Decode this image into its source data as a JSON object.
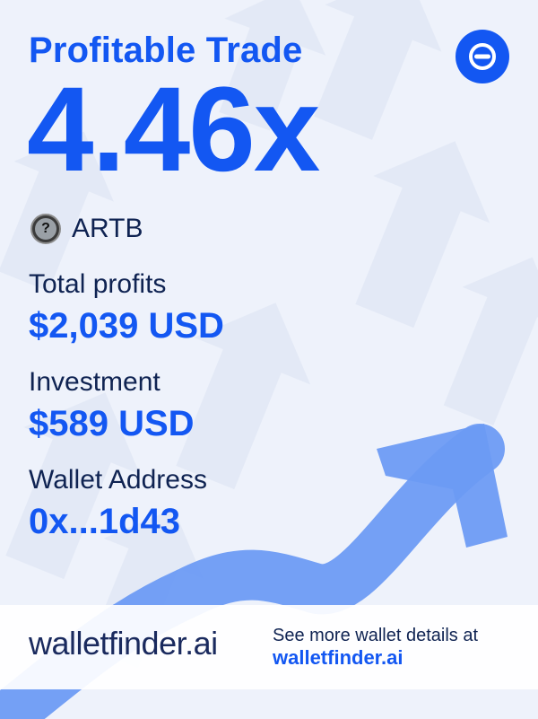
{
  "header": {
    "title": "Profitable Trade",
    "multiplier": "4.46x"
  },
  "token": {
    "icon": "unknown-token-icon",
    "symbol": "ARTB"
  },
  "stats": {
    "total_profits_label": "Total profits",
    "total_profits_value": "$2,039 USD",
    "investment_label": "Investment",
    "investment_value": "$589 USD",
    "wallet_label": "Wallet Address",
    "wallet_value": "0x...1d43"
  },
  "footer": {
    "brand": "walletfinder.ai",
    "note": "See more wallet details at",
    "link": "walletfinder.ai"
  },
  "colors": {
    "accent": "#1357f2",
    "text_dark": "#0f2352",
    "background": "#eef2fb",
    "arrow": "#6d9bf4"
  }
}
